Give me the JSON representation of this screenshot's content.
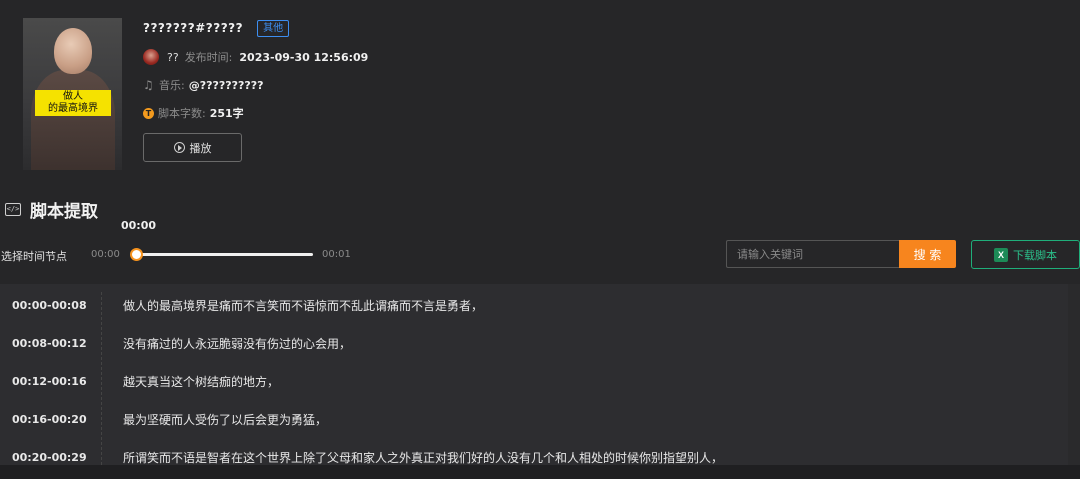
{
  "thumbnail": {
    "caption_line1": "做人",
    "caption_line2": "的最高境界"
  },
  "video": {
    "title": "???????#?????",
    "tag": "其他",
    "author": "??",
    "publish_label": "发布时间:",
    "publish_time": "2023-09-30 12:56:09",
    "music_label": "音乐:",
    "music_value": "@??????????",
    "word_count_label": "脚本字数:",
    "word_count": "251字",
    "play_label": "播放"
  },
  "section": {
    "icon": "code-icon",
    "title": "脚本提取"
  },
  "timeline": {
    "current": "00:00",
    "label": "选择时间节点",
    "start": "00:00",
    "end": "00:01",
    "position": 0
  },
  "search": {
    "placeholder": "请输入关键词",
    "button": "搜 索"
  },
  "download": {
    "label": "下载脚本",
    "icon": "excel-icon"
  },
  "colors": {
    "accent": "#f7851e",
    "tag": "#3d8ef0",
    "download": "#2bc08a"
  },
  "script_rows": [
    {
      "time": "00:00-00:08",
      "text": "做人的最高境界是痛而不言笑而不语惊而不乱此谓痛而不言是勇者，"
    },
    {
      "time": "00:08-00:12",
      "text": "没有痛过的人永远脆弱没有伤过的心会用，"
    },
    {
      "time": "00:12-00:16",
      "text": "越天真当这个树结痂的地方，"
    },
    {
      "time": "00:16-00:20",
      "text": "最为坚硬而人受伤了以后会更为勇猛，"
    },
    {
      "time": "00:20-00:29",
      "text": "所谓笑而不语是智者在这个世界上除了父母和家人之外真正对我们好的人没有几个和人相处的时候你别指望别人，"
    }
  ]
}
